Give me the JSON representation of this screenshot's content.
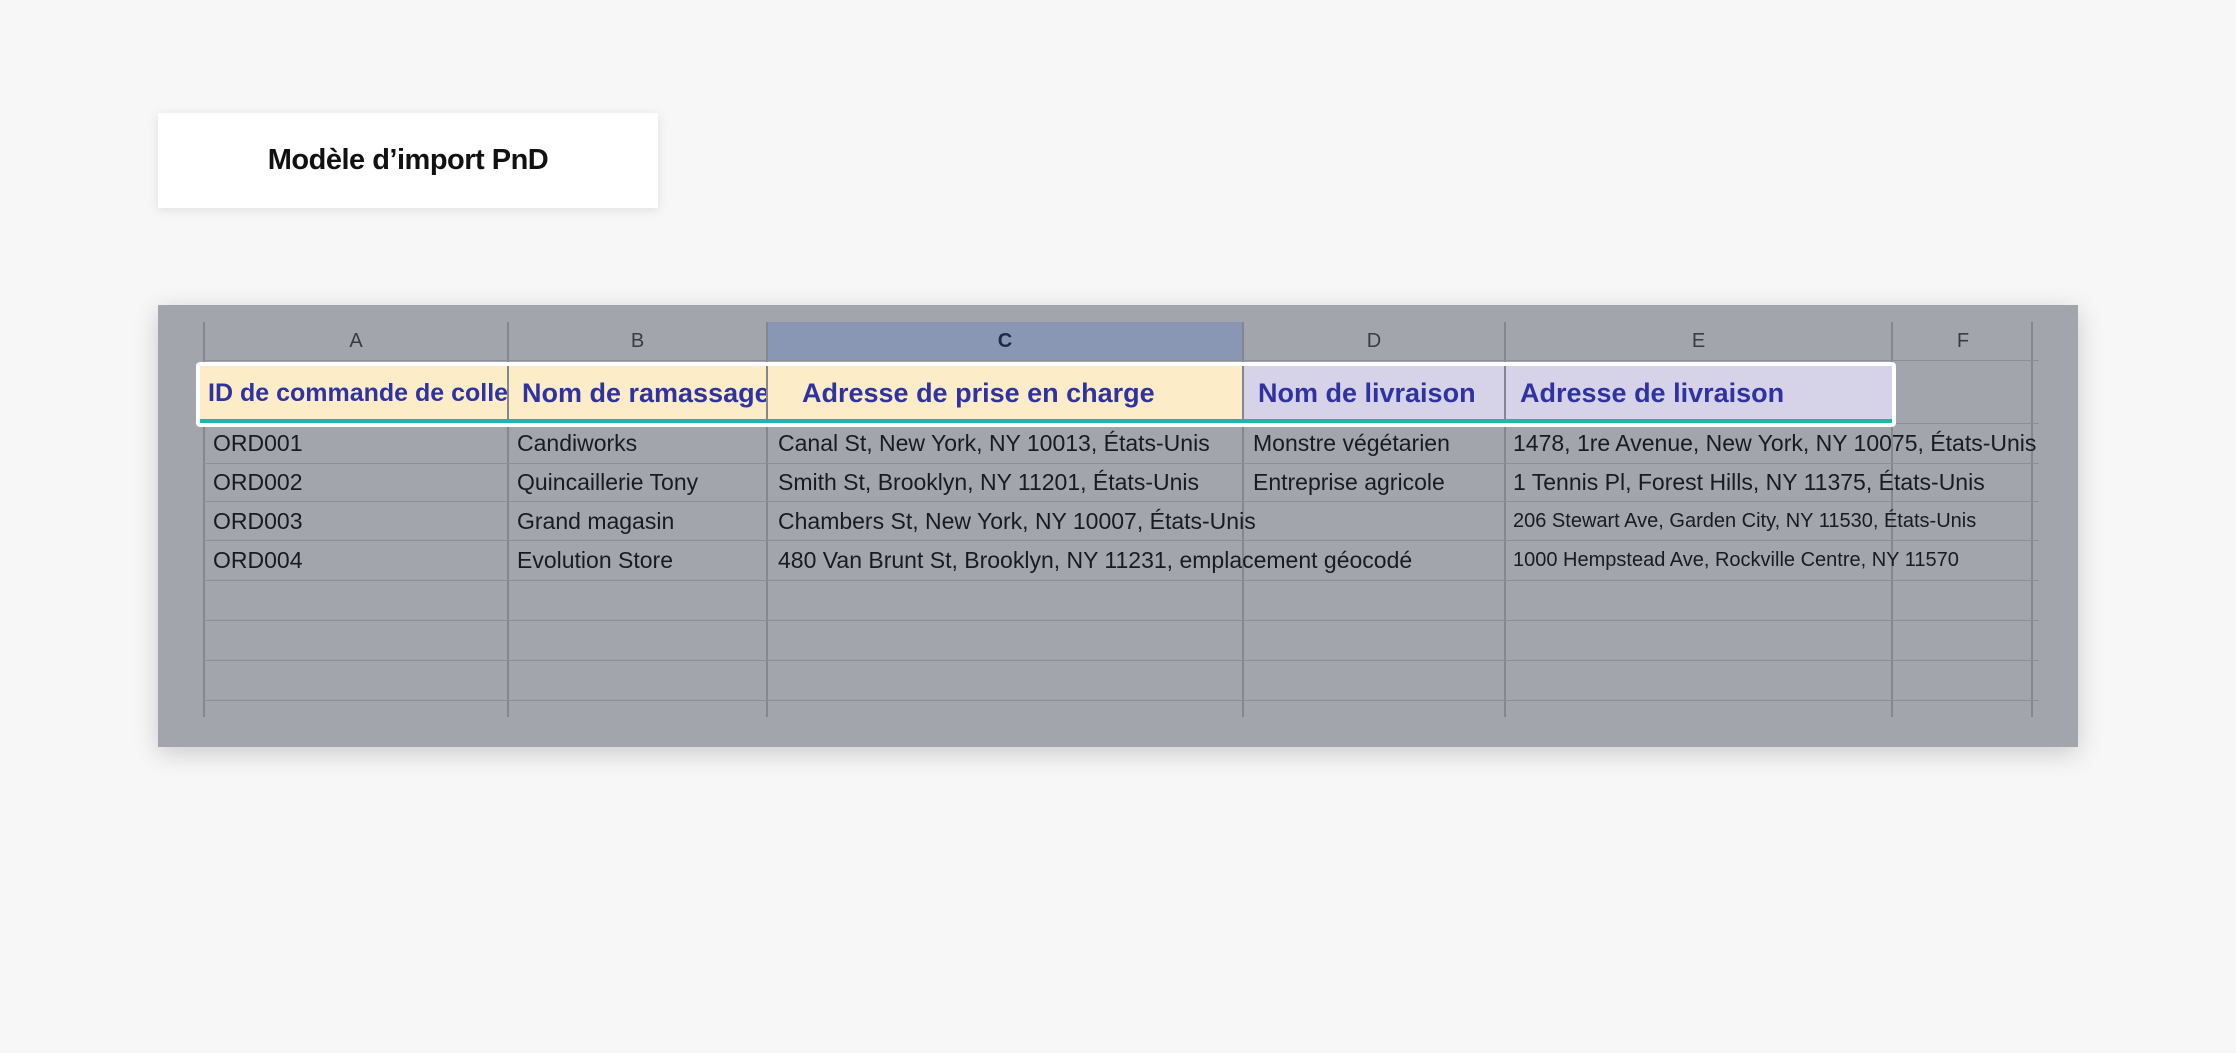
{
  "title_card": {
    "label": "Modèle d’import PnD"
  },
  "sheet": {
    "column_letters": [
      "A",
      "B",
      "C",
      "D",
      "E",
      "F"
    ],
    "selected_column": "C",
    "headers": {
      "pickup_id": "ID de commande de collecte",
      "pickup_name": "Nom de ramassage",
      "pickup_address": "Adresse de prise en charge",
      "delivery_name": "Nom de livraison",
      "delivery_address": "Adresse de livraison"
    },
    "header_colors": {
      "pickup": "#fcecc8",
      "delivery": "#d6d2e7",
      "text": "#2e33a0",
      "underline": "#24b3a8"
    },
    "rows": [
      {
        "id": "ORD001",
        "pickup_name": "Candiworks",
        "pickup_address": "Canal St, New York, NY 10013, États-Unis",
        "delivery_name": "Monstre végétarien",
        "delivery_address": "1478, 1re Avenue, New York, NY 10075, États-Unis"
      },
      {
        "id": "ORD002",
        "pickup_name": "Quincaillerie Tony",
        "pickup_address": "Smith St, Brooklyn, NY 11201, États-Unis",
        "delivery_name": "Entreprise agricole",
        "delivery_address": "1 Tennis Pl, Forest Hills, NY 11375, États-Unis"
      },
      {
        "id": "ORD003",
        "pickup_name": "Grand magasin",
        "pickup_address": "Chambers St, New York, NY 10007, États-Unis",
        "delivery_name": "",
        "delivery_address": "206 Stewart Ave, Garden City, NY 11530, États-Unis"
      },
      {
        "id": "ORD004",
        "pickup_name": "Evolution Store",
        "pickup_address": "480 Van Brunt St, Brooklyn, NY 11231, emplacement géocodé",
        "delivery_name": "",
        "delivery_address": "1000 Hempstead Ave, Rockville Centre, NY 11570"
      }
    ]
  }
}
